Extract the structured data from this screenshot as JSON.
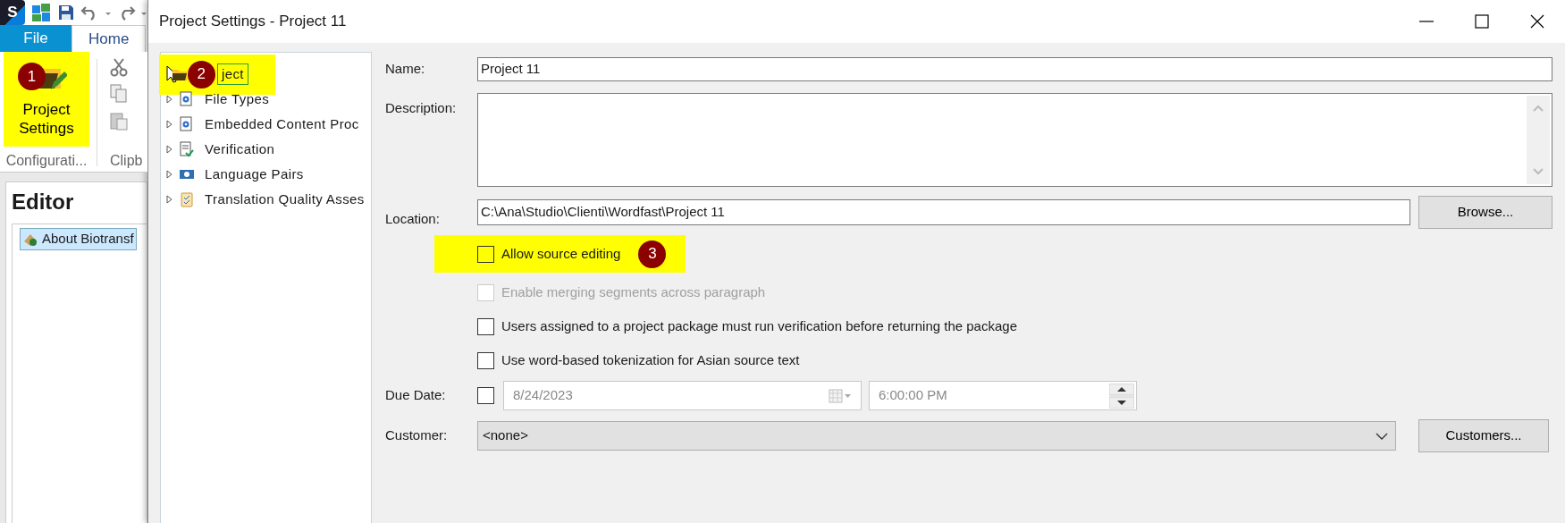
{
  "app": {
    "logo": "S",
    "tabs": [
      {
        "label": "File",
        "selected": false,
        "kind": "file"
      },
      {
        "label": "Home",
        "selected": true,
        "kind": "tab"
      }
    ],
    "ribbon": {
      "big_button": {
        "label": "Project Settings",
        "highlighted": true,
        "badge": "1"
      },
      "groups": [
        "Configurati...",
        "Clipb"
      ]
    },
    "editor": {
      "title": "Editor",
      "tree": [
        {
          "label": "About Biotransf",
          "selected": true
        }
      ]
    }
  },
  "dialog": {
    "title": "Project Settings - Project 11",
    "tree": [
      {
        "label": "ject",
        "selected": true,
        "highlighted": true,
        "badge": "2",
        "kind": "folder"
      },
      {
        "label": "File Types",
        "selected": false,
        "kind": "gear"
      },
      {
        "label": "Embedded Content Proc",
        "selected": false,
        "kind": "gear"
      },
      {
        "label": "Verification",
        "selected": false,
        "kind": "check"
      },
      {
        "label": "Language Pairs",
        "selected": false,
        "kind": "language"
      },
      {
        "label": "Translation Quality Asses",
        "selected": false,
        "kind": "clipboard"
      }
    ],
    "name": {
      "label": "Name:",
      "value": "Project 11"
    },
    "description": {
      "label": "Description:"
    },
    "location": {
      "label": "Location:",
      "value": "C:\\Ana\\Studio\\Clienti\\Wordfast\\Project 11",
      "button": "Browse..."
    },
    "options": [
      {
        "label": "Allow source editing",
        "checked": false,
        "disabled": false,
        "highlighted": true,
        "badge": "3"
      },
      {
        "label": "Enable merging segments across paragraph",
        "checked": false,
        "disabled": true
      },
      {
        "label": "Users assigned to a project package must run verification before returning the package",
        "checked": false,
        "disabled": false
      },
      {
        "label": "Use word-based tokenization for Asian source text",
        "checked": false,
        "disabled": false
      }
    ],
    "due_date": {
      "label": "Due Date:",
      "checked": false,
      "date": "8/24/2023",
      "time": "6:00:00 PM"
    },
    "customer": {
      "label": "Customer:",
      "value": "<none>",
      "button": "Customers..."
    }
  }
}
